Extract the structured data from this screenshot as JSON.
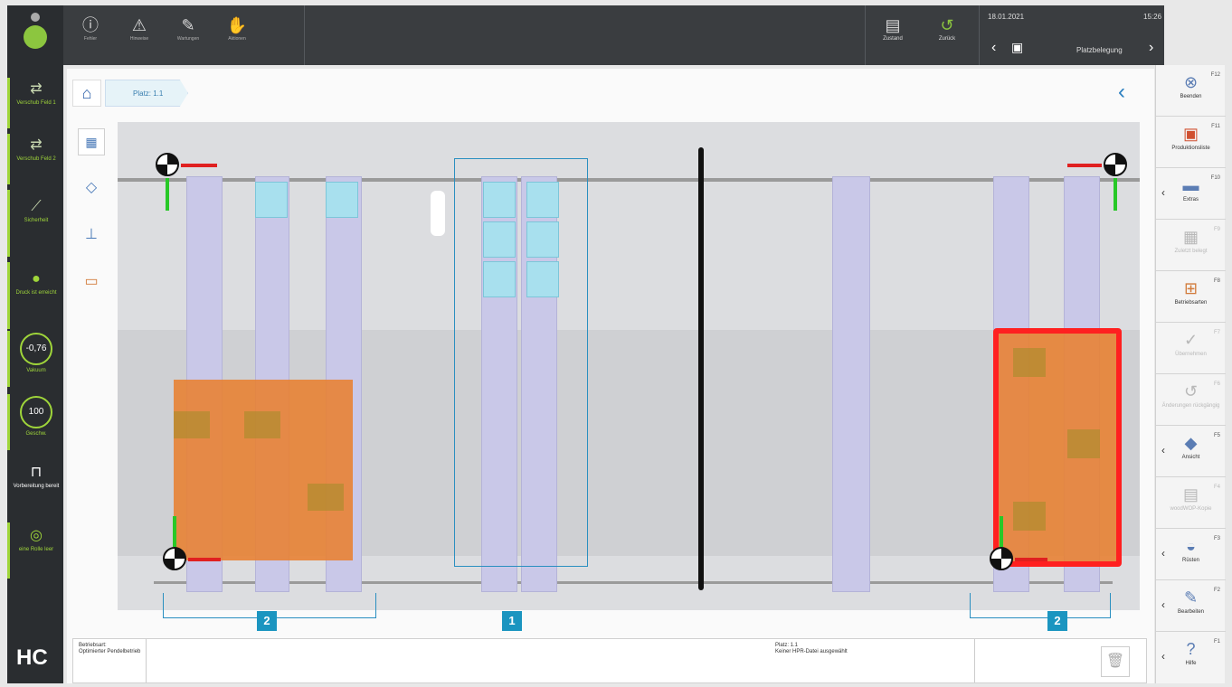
{
  "leftbar": {
    "items": [
      {
        "icon": "vacuum-icon",
        "label": "Verschub Feld 1"
      },
      {
        "icon": "vacuum-icon",
        "label": "Verschub Feld 2"
      },
      {
        "icon": "safety-icon",
        "label": "Sicherheit"
      },
      {
        "icon": "pressure-icon",
        "label": "Druck ist erreicht"
      },
      {
        "icon": "vacuum-gauge-icon",
        "label": "Vakuum",
        "value": "-0,76"
      },
      {
        "icon": "speed-gauge-icon",
        "label": "Geschw.",
        "value": "100"
      },
      {
        "icon": "clamp-icon",
        "label": "Vorbereitung bereit"
      },
      {
        "icon": "roller-icon",
        "label": "eine Rolle leer"
      }
    ],
    "logo": "HC"
  },
  "topbar": {
    "buttons": [
      {
        "icon": "error-icon",
        "glyph": "ⓘ",
        "label": "Fehler"
      },
      {
        "icon": "warning-icon",
        "glyph": "⚠",
        "label": "Hinweise"
      },
      {
        "icon": "wrench-icon",
        "glyph": "✎",
        "label": "Wartungen"
      },
      {
        "icon": "hand-icon",
        "glyph": "✋",
        "label": "Aktionen"
      }
    ],
    "state_label": "Zustand",
    "back_label": "Zurück",
    "date": "18.01.2021",
    "time": "15:26",
    "screen_title": "Platzbelegung"
  },
  "breadcrumb": {
    "label": "Platz: 1.1"
  },
  "rightbar": {
    "items": [
      {
        "icon": "close-circle-icon",
        "fkey": "F12",
        "label": "Beenden",
        "enabled": true,
        "chevron": false
      },
      {
        "icon": "program-icon",
        "fkey": "F11",
        "label": "Produktionsliste",
        "enabled": true,
        "chevron": false
      },
      {
        "icon": "extra-icon",
        "fkey": "F10",
        "label": "Extras",
        "enabled": true,
        "chevron": true
      },
      {
        "icon": "park-icon",
        "fkey": "F9",
        "label": "Zuletzt belegt",
        "enabled": false,
        "chevron": false
      },
      {
        "icon": "mode-icon",
        "fkey": "F8",
        "label": "Betriebsarten",
        "enabled": true,
        "chevron": false
      },
      {
        "icon": "check-icon",
        "fkey": "F7",
        "label": "Übernehmen",
        "enabled": false,
        "chevron": false
      },
      {
        "icon": "undo-icon",
        "fkey": "F6",
        "label": "Änderungen rückgängig",
        "enabled": false,
        "chevron": false
      },
      {
        "icon": "view-icon",
        "fkey": "F5",
        "label": "Ansicht",
        "enabled": true,
        "chevron": true
      },
      {
        "icon": "file-icon",
        "fkey": "F4",
        "label": "woodWOP-Kopie",
        "enabled": false,
        "chevron": false
      },
      {
        "icon": "clamp-tool-icon",
        "fkey": "F3",
        "label": "Rüsten",
        "enabled": true,
        "chevron": true
      },
      {
        "icon": "pencil-icon",
        "fkey": "F2",
        "label": "Bearbeiten",
        "enabled": true,
        "chevron": true
      },
      {
        "icon": "help-icon",
        "fkey": "F1",
        "label": "Hilfe",
        "enabled": true,
        "chevron": true
      }
    ]
  },
  "sidetools": [
    {
      "icon": "layout-icon"
    },
    {
      "icon": "pods-icon"
    },
    {
      "icon": "edit-board-icon"
    },
    {
      "icon": "toolbox-icon"
    }
  ],
  "callouts": {
    "center": "1",
    "left": "2",
    "right": "2"
  },
  "status": {
    "left_title": "Betriebsart:",
    "left_value": "Optimierter Pendelbetrieb",
    "mid_title": "Platz: 1.1",
    "mid_value": "Keiner HPR-Datei ausgewählt"
  },
  "colors": {
    "accent": "#9fd53a",
    "callout": "#1b95c0",
    "panel": "#e88030",
    "alert": "#ff2020"
  }
}
